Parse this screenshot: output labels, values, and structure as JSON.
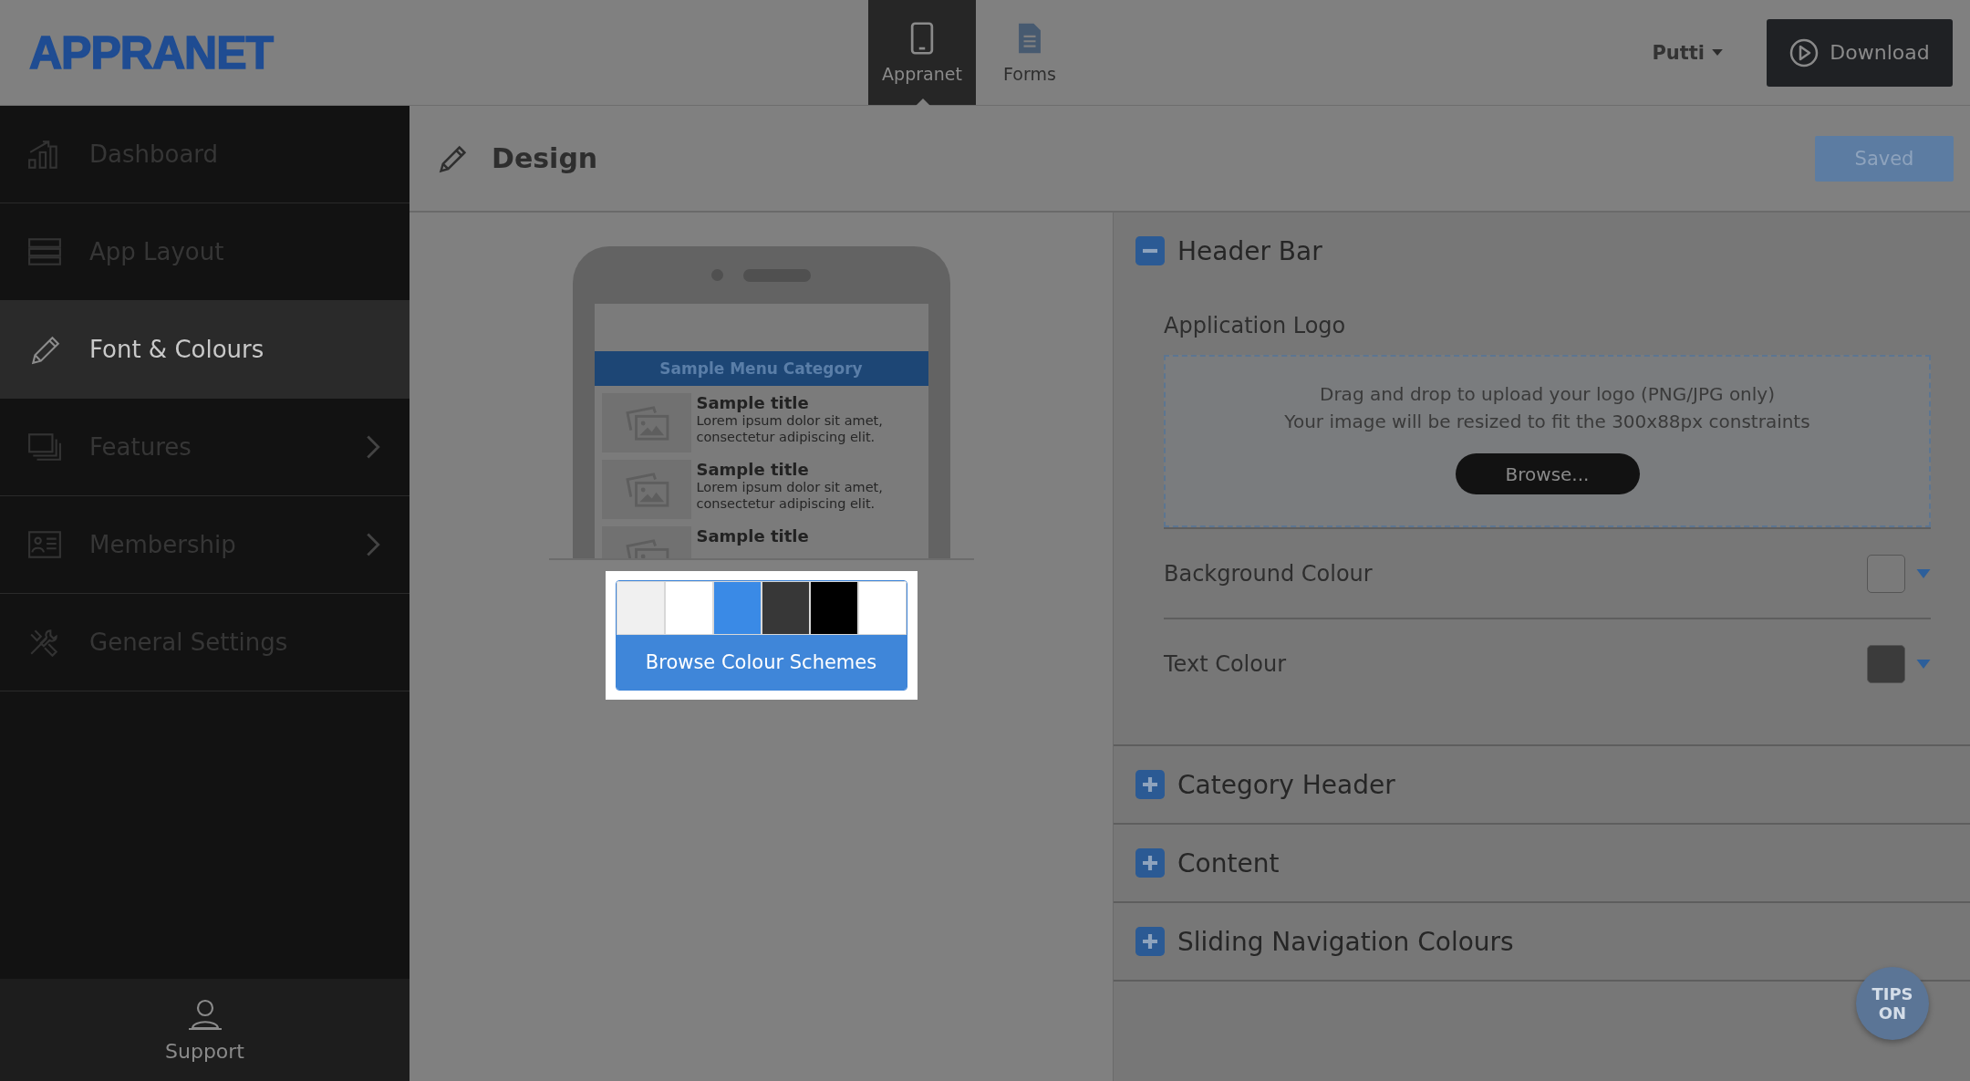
{
  "logo": "APPRANET",
  "top_tabs": [
    {
      "label": "Appranet",
      "kind": "phone",
      "selected": true
    },
    {
      "label": "Forms",
      "kind": "document",
      "selected": false
    }
  ],
  "user_menu": "Putti",
  "download_button": "Download",
  "sidebar": {
    "items": [
      {
        "label": "Dashboard",
        "kind": "chart",
        "selected": false,
        "has_submenu": false
      },
      {
        "label": "App Layout",
        "kind": "layout",
        "selected": false,
        "has_submenu": false
      },
      {
        "label": "Font & Colours",
        "kind": "pencil",
        "selected": true,
        "has_submenu": false
      },
      {
        "label": "Features",
        "kind": "stack",
        "selected": false,
        "has_submenu": true
      },
      {
        "label": "Membership",
        "kind": "card",
        "selected": false,
        "has_submenu": true
      },
      {
        "label": "General Settings",
        "kind": "tools",
        "selected": false,
        "has_submenu": false
      }
    ],
    "support": "Support"
  },
  "page_title": "Design",
  "save_button": "Saved",
  "preview": {
    "category": "Sample Menu Category",
    "items": [
      {
        "title": "Sample title",
        "text": "Lorem ipsum dolor sit amet, consectetur adipiscing elit."
      },
      {
        "title": "Sample title",
        "text": "Lorem ipsum dolor sit amet, consectetur adipiscing elit."
      },
      {
        "title": "Sample title"
      }
    ]
  },
  "colour_scheme": {
    "swatches": [
      {
        "color": "#f0f0f0"
      },
      {
        "color": "#ffffff"
      },
      {
        "color": "#3a8ae6"
      },
      {
        "color": "#373737"
      },
      {
        "color": "#000000"
      },
      {
        "color": "#ffffff"
      }
    ],
    "button": "Browse Colour Schemes"
  },
  "sections": [
    {
      "title": "Header Bar",
      "expanded": true,
      "logo_label": "Application Logo",
      "dropzone_lines": [
        "Drag and drop to upload your logo (PNG/JPG only)",
        "Your image will be resized to fit the 300x88px constraints"
      ],
      "browse_button": "Browse...",
      "colour_fields": [
        {
          "label": "Background Colour",
          "color": "#7a7a7a"
        },
        {
          "label": "Text Colour",
          "color": "#3b3b3b"
        }
      ]
    },
    {
      "title": "Category Header",
      "expanded": false
    },
    {
      "title": "Content",
      "expanded": false
    },
    {
      "title": "Sliding Navigation Colours",
      "expanded": false
    }
  ],
  "tips_button": "TIPS ON"
}
